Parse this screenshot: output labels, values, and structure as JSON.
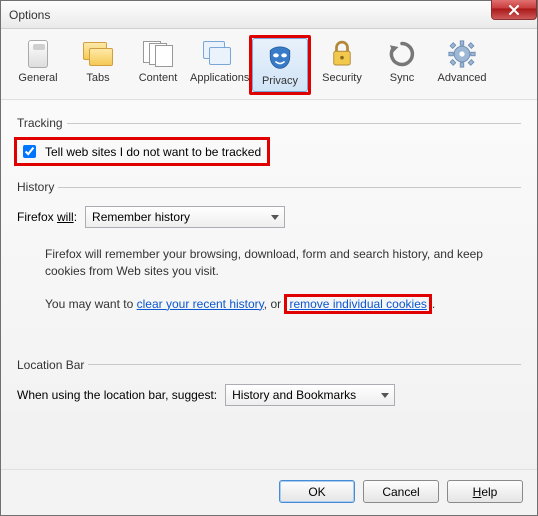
{
  "window": {
    "title": "Options"
  },
  "toolbar": {
    "items": [
      {
        "label": "General"
      },
      {
        "label": "Tabs"
      },
      {
        "label": "Content"
      },
      {
        "label": "Applications"
      },
      {
        "label": "Privacy"
      },
      {
        "label": "Security"
      },
      {
        "label": "Sync"
      },
      {
        "label": "Advanced"
      }
    ],
    "selected": "Privacy"
  },
  "tracking": {
    "legend": "Tracking",
    "do_not_track_label": "Tell web sites I do not want to be tracked",
    "do_not_track_checked": true
  },
  "history": {
    "legend": "History",
    "prefix": "Firefox ",
    "will_u": "will",
    "suffix": ":",
    "mode_selected": "Remember history",
    "desc": "Firefox will remember your browsing, download, form and search history, and keep cookies from Web sites you visit.",
    "hint_prefix": "You may want to ",
    "link_clear": "clear your recent history",
    "hint_mid": ", or ",
    "link_cookies": "remove individual cookies",
    "hint_suffix": "."
  },
  "location_bar": {
    "legend": "Location Bar",
    "label": "When using the location bar, suggest:",
    "selected": "History and Bookmarks"
  },
  "buttons": {
    "ok": "OK",
    "cancel": "Cancel",
    "help_pre": "H",
    "help_u": "elp",
    "help_full": "Help"
  }
}
